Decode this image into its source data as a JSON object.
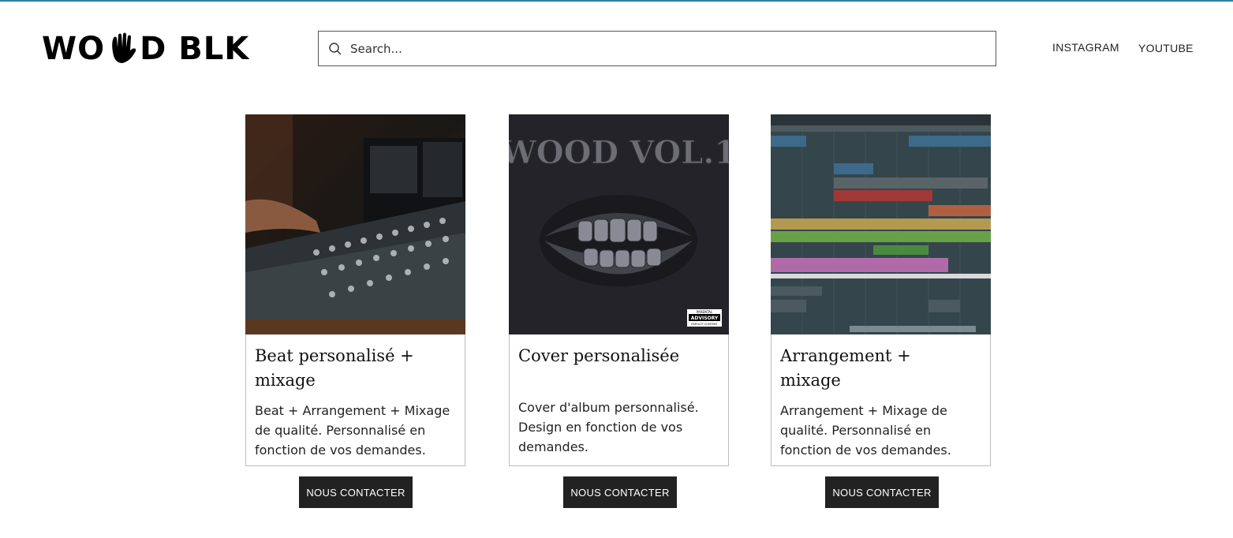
{
  "header": {
    "logo_text_left": "WO",
    "logo_text_right": "D BLK",
    "search": {
      "placeholder": "Search...",
      "value": ""
    },
    "nav": [
      {
        "label": "INSTAGRAM"
      },
      {
        "label": "YOUTUBE"
      }
    ]
  },
  "cards": [
    {
      "title": "Beat personalisé + mixage",
      "description": "Beat + Arrangement + Mixage de qualité. Personnalisé en fonction de vos demandes.",
      "image": "mixing-console-photo",
      "button": "NOUS CONTACTER"
    },
    {
      "title": "Cover personalisée",
      "description": "Cover d'album personnalisé. Design en fonction de vos demandes.",
      "image": "album-cover-art",
      "cover_title": "WOOD VOL.1",
      "cover_badge": "PARENTAL ADVISORY EXPLICIT CONTENT",
      "button": "NOUS CONTACTER"
    },
    {
      "title": "Arrangement + mixage",
      "description": "Arrangement + Mixage de qualité. Personnalisé en fonction de vos demandes.",
      "image": "daw-arrangement-screenshot",
      "button": "NOUS CONTACTER"
    }
  ],
  "colors": {
    "accent_line": "#2f7fa0",
    "button_bg": "#222222",
    "text": "#111111"
  }
}
